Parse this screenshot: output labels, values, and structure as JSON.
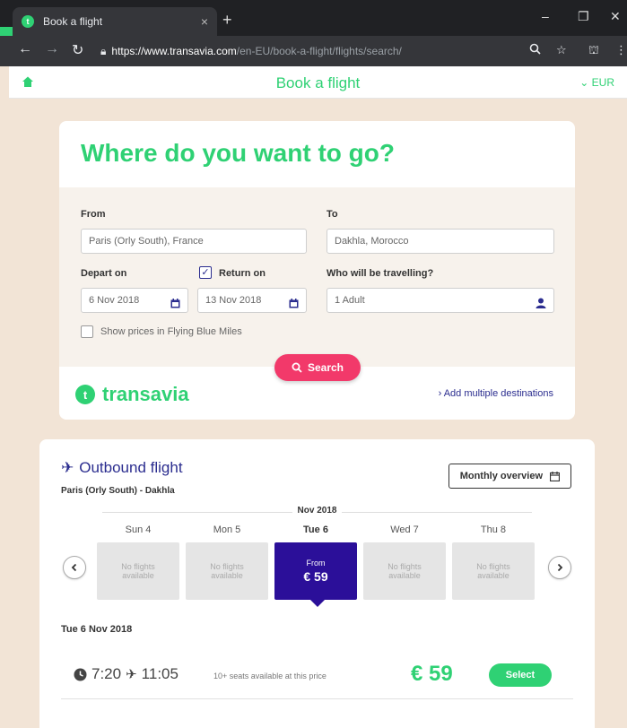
{
  "browser": {
    "tab_title": "Book a flight",
    "tab_close": "×",
    "new_tab": "+",
    "url_host": "https://www.transavia.com",
    "url_path": "/en-EU/book-a-flight/flights/search/",
    "controls": {
      "minimize": "–",
      "maximize": "❐",
      "close": "✕"
    }
  },
  "header": {
    "title": "Book a flight",
    "currency": "⌄ EUR"
  },
  "search": {
    "heading": "Where do you want to go?",
    "from_label": "From",
    "from_value": "Paris (Orly South), France",
    "to_label": "To",
    "to_value": "Dakhla, Morocco",
    "depart_label": "Depart on",
    "depart_value": "6 Nov 2018",
    "return_label": "Return on",
    "return_value": "13 Nov 2018",
    "travellers_label": "Who will be travelling?",
    "travellers_value": "1 Adult",
    "miles_label": "Show prices in Flying Blue Miles",
    "search_button": "Search",
    "brand": "transavia",
    "add_destinations": "› Add multiple destinations"
  },
  "results": {
    "title": "Outbound flight",
    "route": "Paris (Orly South) - Dakhla",
    "monthly_button": "Monthly overview",
    "month": "Nov 2018",
    "days": [
      {
        "label": "Sun 4",
        "text": "No flights available"
      },
      {
        "label": "Mon 5",
        "text": "No flights available"
      },
      {
        "label": "Tue 6",
        "from": "From",
        "price": "€ 59"
      },
      {
        "label": "Wed 7",
        "text": "No flights available"
      },
      {
        "label": "Thu 8",
        "text": "No flights available"
      }
    ],
    "selected_date": "Tue 6 Nov 2018",
    "flight": {
      "depart": "7:20",
      "arrive": "11:05",
      "seats": "10+ seats available at this price",
      "price": "€ 59",
      "select": "Select"
    }
  },
  "colors": {
    "brand_green": "#2fd174",
    "navy": "#2b2d8f",
    "selected_day": "#2b0f99",
    "search_pink": "#f2396a",
    "page_bg": "#f2e4d6"
  }
}
